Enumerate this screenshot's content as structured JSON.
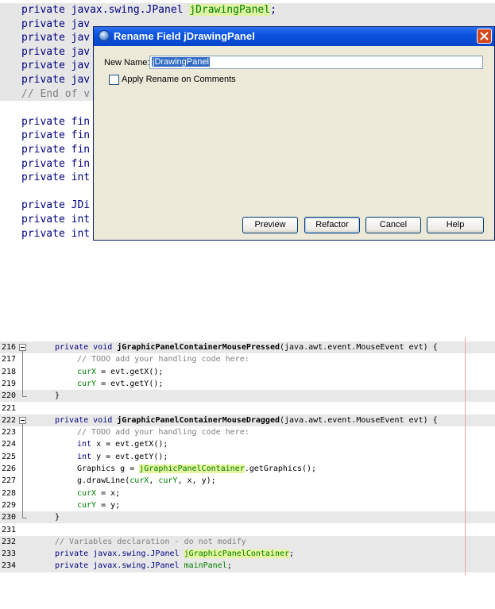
{
  "top_editor": {
    "lines": [
      {
        "text": "private javax.swing.JPanel ",
        "highlight": "jDrawingPanel",
        "suffix": ";",
        "guarded": true
      },
      {
        "text": "private jav",
        "guarded": true
      },
      {
        "text": "private jav",
        "guarded": true
      },
      {
        "text": "private jav",
        "guarded": true
      },
      {
        "text": "private jav",
        "guarded": true
      },
      {
        "text": "private jav",
        "guarded": true
      },
      {
        "text": "// End of v",
        "guarded": true,
        "comment": true
      },
      {
        "text": "",
        "guarded": false
      },
      {
        "text": "private fin",
        "guarded": false
      },
      {
        "text": "private fin",
        "guarded": false
      },
      {
        "text": "private fin",
        "guarded": false
      },
      {
        "text": "private fin",
        "guarded": false
      },
      {
        "text": "private int",
        "guarded": false
      },
      {
        "text": "",
        "guarded": false
      },
      {
        "text": "private JDi",
        "guarded": false
      },
      {
        "text": "private int",
        "guarded": false
      },
      {
        "text": "private int",
        "guarded": false
      }
    ]
  },
  "dialog": {
    "title": "Rename Field jDrawingPanel",
    "new_name_label": "New Name:",
    "new_name_value": "jDrawingPanel",
    "apply_rename_label": "Apply Rename on Comments",
    "buttons": {
      "preview": "Preview",
      "refactor": "Refactor",
      "cancel": "Cancel",
      "help": "Help"
    },
    "colors": {
      "titlebar": "#0a54e0",
      "body": "#ece9d8",
      "close": "#d5461c"
    }
  },
  "bottom_editor": {
    "line_numbers": [
      "216",
      "217",
      "218",
      "219",
      "220",
      "221",
      "222",
      "223",
      "224",
      "225",
      "226",
      "227",
      "228",
      "229",
      "230",
      "231",
      "232",
      "233",
      "234"
    ],
    "lines": {
      "l216": {
        "kw": "private void ",
        "method": "jGraphicPanelContainerMousePressed",
        "rest": "(java.awt.event.MouseEvent evt) {"
      },
      "l217": "// TODO add your handling code here:",
      "l218a": "curX",
      "l218b": " = evt.getX();",
      "l219a": "curY",
      "l219b": " = evt.getY();",
      "l220": "}",
      "l222": {
        "kw": "private void ",
        "method": "jGraphicPanelContainerMouseDragged",
        "rest": "(java.awt.event.MouseEvent evt) {"
      },
      "l223": "// TODO add your handling code here:",
      "l224a": "int",
      "l224b": " x = evt.getX();",
      "l225a": "int",
      "l225b": " y = evt.getY();",
      "l226a": "Graphics g = ",
      "l226b": "jGraphicPanelContainer",
      "l226c": ".getGraphics();",
      "l227a": "g.drawLine(",
      "l227b": "curX",
      "l227c": ", ",
      "l227d": "curY",
      "l227e": ", x, y);",
      "l228a": "curX",
      "l228b": " = x;",
      "l229a": "curY",
      "l229b": " = y;",
      "l230": "}",
      "l232": "// Variables declaration - do not modify",
      "l233a": "private javax.swing.JPanel ",
      "l233b": "jGraphicPanelContainer",
      "l233c": ";",
      "l234a": "private javax.swing.JPanel ",
      "l234b": "mainPanel",
      "l234c": ";"
    }
  }
}
